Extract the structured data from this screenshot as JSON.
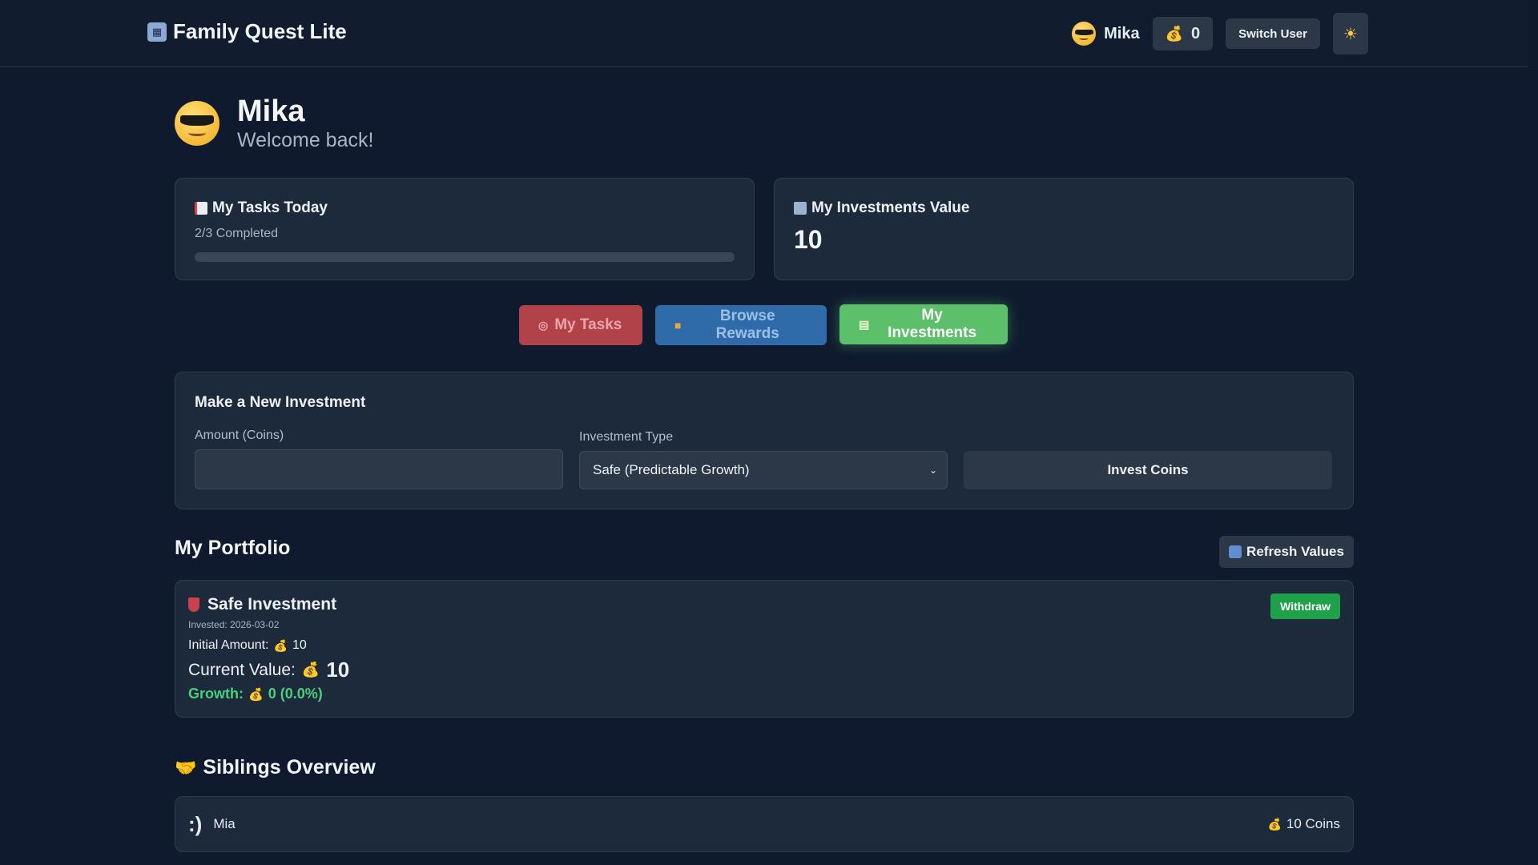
{
  "header": {
    "brand": "Family Quest Lite",
    "user_name": "Mika",
    "coins": "0",
    "switch_user": "Switch User",
    "theme_icon": "sun-icon"
  },
  "profile": {
    "name": "Mika",
    "subtitle": "Welcome back!"
  },
  "tasks_card": {
    "title": "My Tasks Today",
    "status": "2/3 Completed"
  },
  "investments_card": {
    "title": "My Investments Value",
    "value": "10"
  },
  "tabs": [
    {
      "label": "My Tasks",
      "icon": "target-icon"
    },
    {
      "label": "Browse Rewards",
      "icon": "gift-icon"
    },
    {
      "label": "My Investments",
      "icon": "money-icon"
    }
  ],
  "new_investment": {
    "title": "Make a New Investment",
    "amount_label": "Amount (Coins)",
    "amount_value": "",
    "type_label": "Investment Type",
    "type_selected": "Safe (Predictable Growth)",
    "submit": "Invest Coins"
  },
  "portfolio": {
    "title": "My Portfolio",
    "refresh": "Refresh Values",
    "items": [
      {
        "name": "Safe Investment",
        "invested": "Invested: 2026-03-02",
        "initial_label": "Initial Amount:",
        "initial_value": "10",
        "current_label": "Current Value:",
        "current_value": "10",
        "growth_label": "Growth:",
        "growth_value": "0 (0.0%)",
        "withdraw": "Withdraw"
      }
    ]
  },
  "siblings": {
    "title": "Siblings Overview",
    "items": [
      {
        "avatar": ":)",
        "name": "Mia",
        "coins": "10 Coins"
      }
    ]
  },
  "colors": {
    "bg": "#0f1a2e",
    "card": "#1d2a3c",
    "tasks_tab": "#b1424a",
    "rewards_tab": "#2f6aa9",
    "invest_tab": "#5cc06a",
    "withdraw": "#1fa14a",
    "growth": "#4ad07a"
  }
}
